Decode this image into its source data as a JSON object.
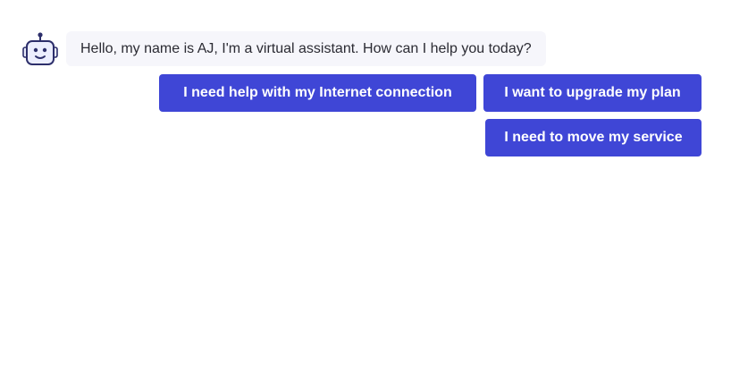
{
  "assistant": {
    "avatar_icon": "robot-icon",
    "message": "Hello, my name is AJ, I'm a virtual assistant. How can I help you today?"
  },
  "quick_replies": [
    "I need help with my Internet connection",
    "I want to upgrade my plan",
    "I need to move my service"
  ],
  "colors": {
    "button_bg": "#3f46d6",
    "button_text": "#ffffff",
    "bubble_bg": "#f6f6fb",
    "robot_outline": "#2d2f6b",
    "robot_face": "#eceefe"
  }
}
